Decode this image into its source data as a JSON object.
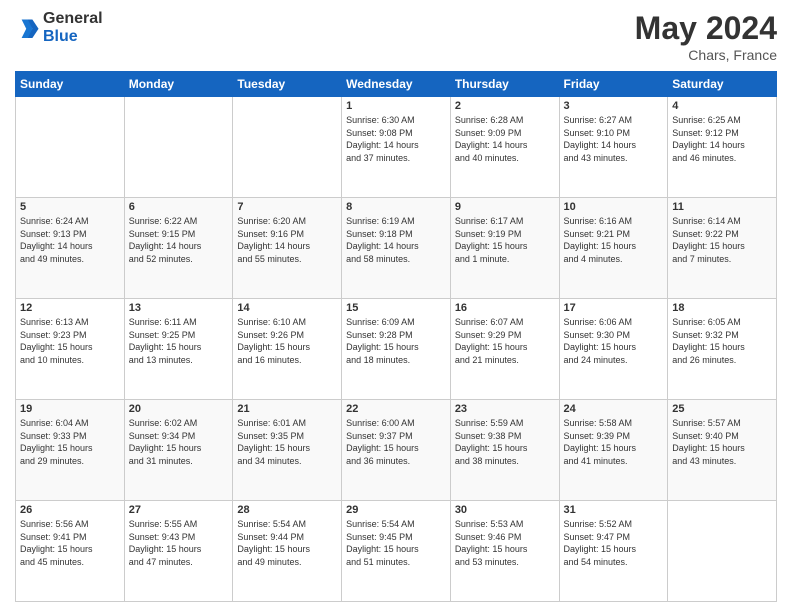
{
  "header": {
    "logo_general": "General",
    "logo_blue": "Blue",
    "month": "May 2024",
    "location": "Chars, France"
  },
  "weekdays": [
    "Sunday",
    "Monday",
    "Tuesday",
    "Wednesday",
    "Thursday",
    "Friday",
    "Saturday"
  ],
  "weeks": [
    [
      {
        "day": "",
        "info": ""
      },
      {
        "day": "",
        "info": ""
      },
      {
        "day": "",
        "info": ""
      },
      {
        "day": "1",
        "info": "Sunrise: 6:30 AM\nSunset: 9:08 PM\nDaylight: 14 hours\nand 37 minutes."
      },
      {
        "day": "2",
        "info": "Sunrise: 6:28 AM\nSunset: 9:09 PM\nDaylight: 14 hours\nand 40 minutes."
      },
      {
        "day": "3",
        "info": "Sunrise: 6:27 AM\nSunset: 9:10 PM\nDaylight: 14 hours\nand 43 minutes."
      },
      {
        "day": "4",
        "info": "Sunrise: 6:25 AM\nSunset: 9:12 PM\nDaylight: 14 hours\nand 46 minutes."
      }
    ],
    [
      {
        "day": "5",
        "info": "Sunrise: 6:24 AM\nSunset: 9:13 PM\nDaylight: 14 hours\nand 49 minutes."
      },
      {
        "day": "6",
        "info": "Sunrise: 6:22 AM\nSunset: 9:15 PM\nDaylight: 14 hours\nand 52 minutes."
      },
      {
        "day": "7",
        "info": "Sunrise: 6:20 AM\nSunset: 9:16 PM\nDaylight: 14 hours\nand 55 minutes."
      },
      {
        "day": "8",
        "info": "Sunrise: 6:19 AM\nSunset: 9:18 PM\nDaylight: 14 hours\nand 58 minutes."
      },
      {
        "day": "9",
        "info": "Sunrise: 6:17 AM\nSunset: 9:19 PM\nDaylight: 15 hours\nand 1 minute."
      },
      {
        "day": "10",
        "info": "Sunrise: 6:16 AM\nSunset: 9:21 PM\nDaylight: 15 hours\nand 4 minutes."
      },
      {
        "day": "11",
        "info": "Sunrise: 6:14 AM\nSunset: 9:22 PM\nDaylight: 15 hours\nand 7 minutes."
      }
    ],
    [
      {
        "day": "12",
        "info": "Sunrise: 6:13 AM\nSunset: 9:23 PM\nDaylight: 15 hours\nand 10 minutes."
      },
      {
        "day": "13",
        "info": "Sunrise: 6:11 AM\nSunset: 9:25 PM\nDaylight: 15 hours\nand 13 minutes."
      },
      {
        "day": "14",
        "info": "Sunrise: 6:10 AM\nSunset: 9:26 PM\nDaylight: 15 hours\nand 16 minutes."
      },
      {
        "day": "15",
        "info": "Sunrise: 6:09 AM\nSunset: 9:28 PM\nDaylight: 15 hours\nand 18 minutes."
      },
      {
        "day": "16",
        "info": "Sunrise: 6:07 AM\nSunset: 9:29 PM\nDaylight: 15 hours\nand 21 minutes."
      },
      {
        "day": "17",
        "info": "Sunrise: 6:06 AM\nSunset: 9:30 PM\nDaylight: 15 hours\nand 24 minutes."
      },
      {
        "day": "18",
        "info": "Sunrise: 6:05 AM\nSunset: 9:32 PM\nDaylight: 15 hours\nand 26 minutes."
      }
    ],
    [
      {
        "day": "19",
        "info": "Sunrise: 6:04 AM\nSunset: 9:33 PM\nDaylight: 15 hours\nand 29 minutes."
      },
      {
        "day": "20",
        "info": "Sunrise: 6:02 AM\nSunset: 9:34 PM\nDaylight: 15 hours\nand 31 minutes."
      },
      {
        "day": "21",
        "info": "Sunrise: 6:01 AM\nSunset: 9:35 PM\nDaylight: 15 hours\nand 34 minutes."
      },
      {
        "day": "22",
        "info": "Sunrise: 6:00 AM\nSunset: 9:37 PM\nDaylight: 15 hours\nand 36 minutes."
      },
      {
        "day": "23",
        "info": "Sunrise: 5:59 AM\nSunset: 9:38 PM\nDaylight: 15 hours\nand 38 minutes."
      },
      {
        "day": "24",
        "info": "Sunrise: 5:58 AM\nSunset: 9:39 PM\nDaylight: 15 hours\nand 41 minutes."
      },
      {
        "day": "25",
        "info": "Sunrise: 5:57 AM\nSunset: 9:40 PM\nDaylight: 15 hours\nand 43 minutes."
      }
    ],
    [
      {
        "day": "26",
        "info": "Sunrise: 5:56 AM\nSunset: 9:41 PM\nDaylight: 15 hours\nand 45 minutes."
      },
      {
        "day": "27",
        "info": "Sunrise: 5:55 AM\nSunset: 9:43 PM\nDaylight: 15 hours\nand 47 minutes."
      },
      {
        "day": "28",
        "info": "Sunrise: 5:54 AM\nSunset: 9:44 PM\nDaylight: 15 hours\nand 49 minutes."
      },
      {
        "day": "29",
        "info": "Sunrise: 5:54 AM\nSunset: 9:45 PM\nDaylight: 15 hours\nand 51 minutes."
      },
      {
        "day": "30",
        "info": "Sunrise: 5:53 AM\nSunset: 9:46 PM\nDaylight: 15 hours\nand 53 minutes."
      },
      {
        "day": "31",
        "info": "Sunrise: 5:52 AM\nSunset: 9:47 PM\nDaylight: 15 hours\nand 54 minutes."
      },
      {
        "day": "",
        "info": ""
      }
    ]
  ]
}
